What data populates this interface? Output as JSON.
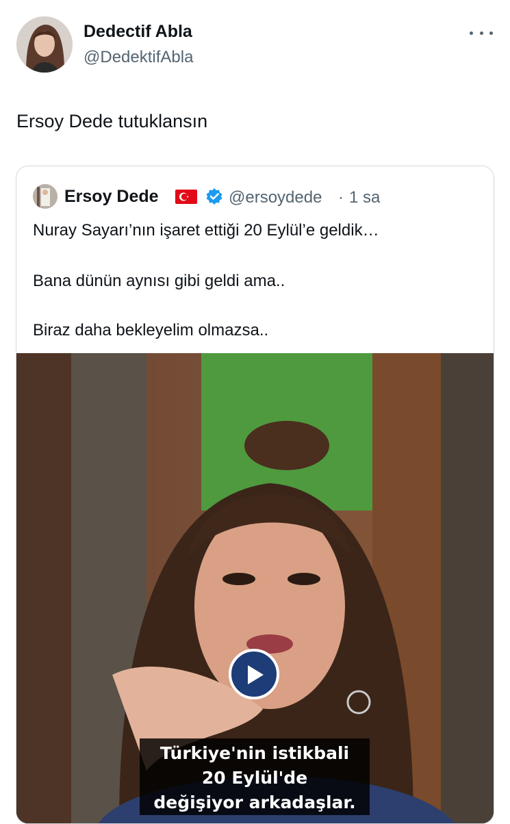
{
  "tweet": {
    "author_name": "Dedectif Abla",
    "author_handle": "@DedektifAbla",
    "text": "Ersoy Dede tutuklansın",
    "more_icon": "more-horizontal-icon"
  },
  "quoted_tweet": {
    "author_name": "Ersoy Dede",
    "author_handle": "@ersoydede",
    "separator": "·",
    "time": "1 sa",
    "flag_icon": "turkey-flag-icon",
    "verified_icon": "verified-badge-icon",
    "lines": [
      "Nuray Sayarı’nın işaret ettiği 20 Eylül’e geldik…",
      "Bana dünün aynısı gibi geldi ama..",
      "Biraz daha bekleyelim olmazsa.."
    ],
    "video": {
      "play_icon": "play-icon",
      "caption_lines": [
        "Türkiye'nin istikbali",
        "20 Eylül'de",
        "değişiyor arkadaşlar."
      ]
    }
  },
  "colors": {
    "text_primary": "#0f1419",
    "text_secondary": "#536471",
    "border": "#cfd9de",
    "verified_blue": "#1d9bf0",
    "play_button": "#1d3c78",
    "flag_red": "#e30a17"
  }
}
